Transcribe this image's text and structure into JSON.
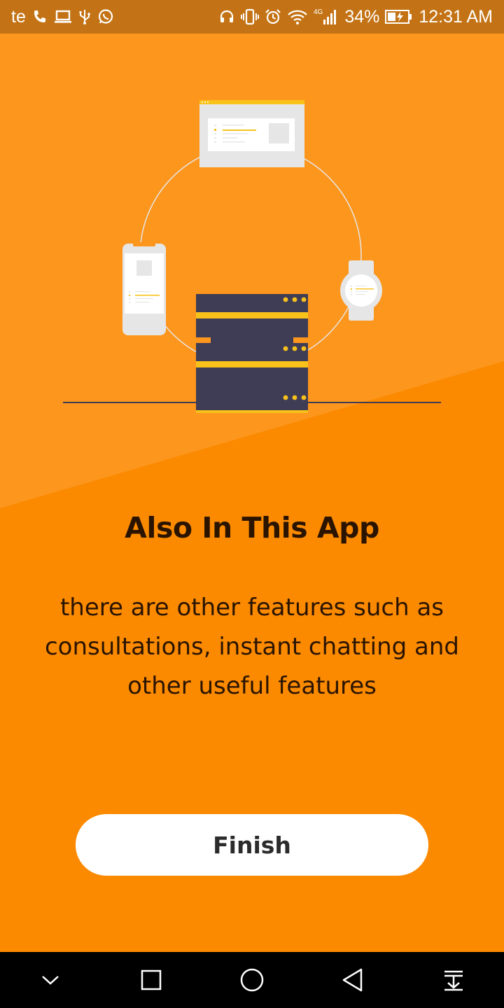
{
  "status_bar": {
    "carrier": "te",
    "battery_percent": "34%",
    "time": "12:31 AM",
    "network": "4G",
    "left_icons": [
      "phone-icon",
      "laptop-icon",
      "usb-icon",
      "whatsapp-icon"
    ],
    "right_icons": [
      "headphones-icon",
      "vibrate-icon",
      "alarm-icon",
      "wifi-icon",
      "signal-icon",
      "battery-charging-icon"
    ]
  },
  "onboarding": {
    "title": "Also In This App",
    "description": "there are other features such as consultations, instant chatting and other useful features",
    "finish_label": "Finish",
    "illustration": "devices-connected-to-server-illustration"
  },
  "nav_bar": {
    "buttons": [
      "chevron-down-icon",
      "recents-square-icon",
      "home-circle-icon",
      "back-triangle-icon",
      "notification-pulldown-icon"
    ]
  },
  "colors": {
    "status_bar_bg": "#c37315",
    "page_bg": "#fb8a00",
    "page_bg_light": "#fd961d",
    "text_dark": "#2a1400",
    "server_dark": "#3f3d56",
    "accent_yellow": "#f9c21b",
    "button_bg": "#ffffff",
    "nav_bg": "#000000"
  }
}
